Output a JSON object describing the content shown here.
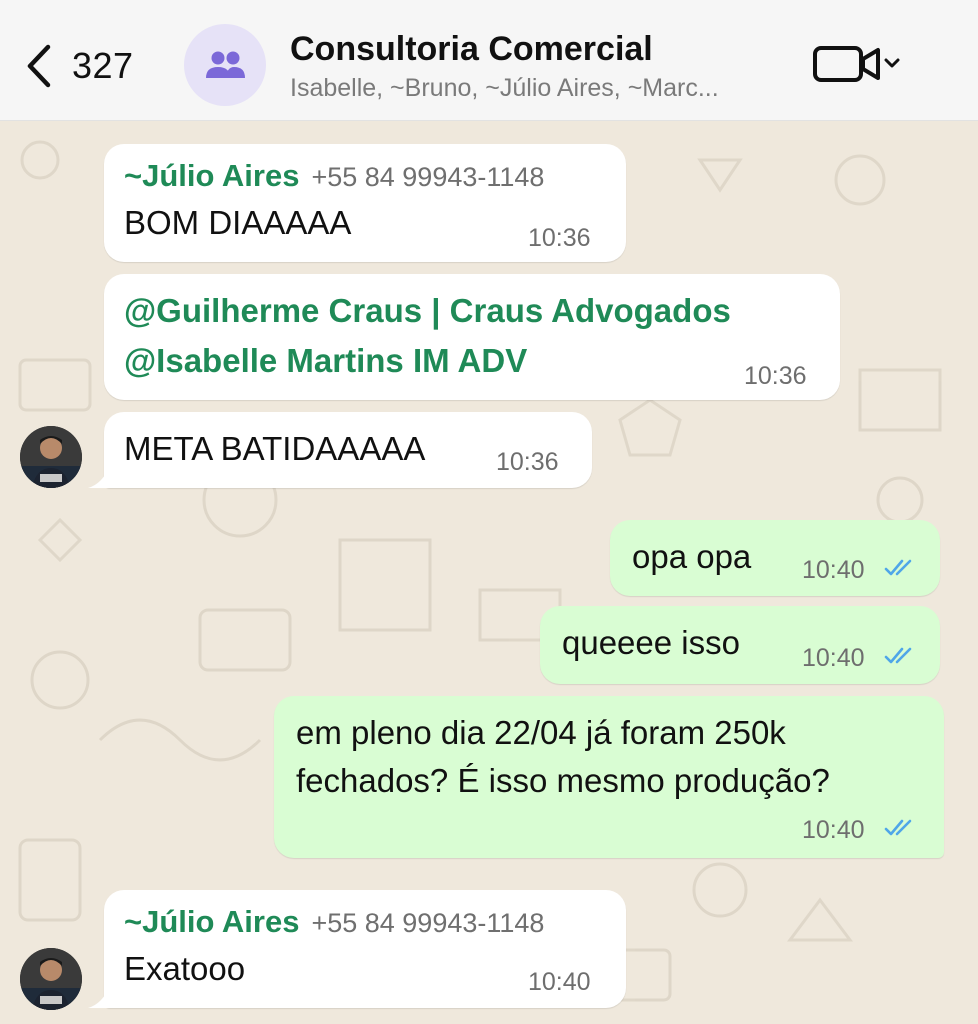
{
  "header": {
    "back_count": "327",
    "group_title": "Consultoria Comercial",
    "group_members": "Isabelle, ~Bruno, ~Júlio Aires, ~Marc..."
  },
  "messages": [
    {
      "sender": "~Júlio Aires",
      "phone": "+55 84 99943-1148",
      "text": "BOM DIAAAAA",
      "time": "10:36"
    },
    {
      "mention1": "@Guilherme Craus | Craus Advogados",
      "mention2": "@Isabelle Martins IM ADV",
      "time": "10:36"
    },
    {
      "text": "META BATIDAAAAA",
      "time": "10:36"
    },
    {
      "text": "opa opa",
      "time": "10:40",
      "status": "read"
    },
    {
      "text": "queeee isso",
      "time": "10:40",
      "status": "read"
    },
    {
      "line1": "em pleno dia 22/04 já foram 250k",
      "line2": "fechados? É isso mesmo produção?",
      "time": "10:40",
      "status": "read"
    },
    {
      "sender": "~Júlio Aires",
      "phone": "+55 84 99943-1148",
      "text": "Exatooo",
      "time": "10:40"
    }
  ],
  "colors": {
    "header_bg": "#f6f6f6",
    "incoming_bubble": "#ffffff",
    "outgoing_bubble": "#d9fdd3",
    "sender_name": "#1f8a57",
    "read_ticks": "#4fa6e8",
    "group_avatar_bg": "#e6e2f7",
    "group_avatar_icon": "#7b68d8"
  },
  "icons": [
    "back-chevron-icon",
    "group-icon",
    "video-call-icon",
    "chevron-down-icon",
    "double-check-icon"
  ]
}
